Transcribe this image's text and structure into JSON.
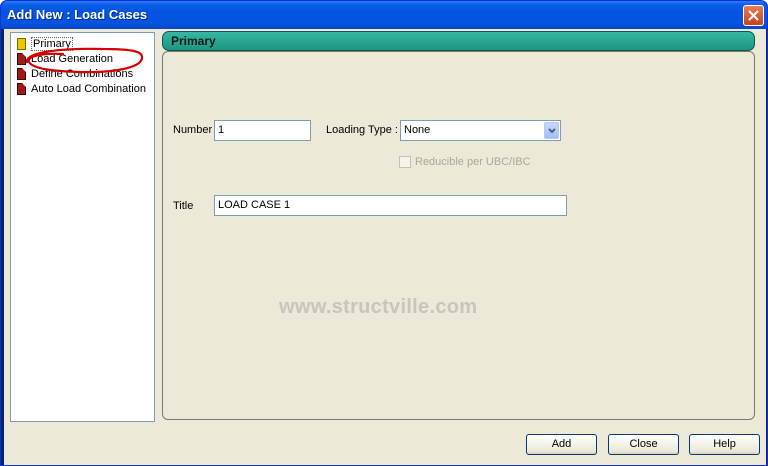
{
  "window": {
    "title": "Add New : Load Cases"
  },
  "tree": {
    "items": [
      {
        "label": "Primary",
        "icon": "yellow-load-icon"
      },
      {
        "label": "Load Generation",
        "icon": "red-load-icon"
      },
      {
        "label": "Define Combinations",
        "icon": "red-load-icon"
      },
      {
        "label": "Auto Load Combination",
        "icon": "red-load-icon"
      }
    ]
  },
  "panel": {
    "header": "Primary",
    "number_label": "Number",
    "number_value": "1",
    "loading_type_label": "Loading Type :",
    "loading_type_value": "None",
    "reducible_label": "Reducible per UBC/IBC",
    "title_label": "Title",
    "title_value": "LOAD CASE 1"
  },
  "watermark": "www.structville.com",
  "buttons": {
    "add": "Add",
    "close": "Close",
    "help": "Help"
  },
  "colors": {
    "titlebar": "#0553e0",
    "panel_header": "#2aa590",
    "annotation": "#d40000"
  }
}
